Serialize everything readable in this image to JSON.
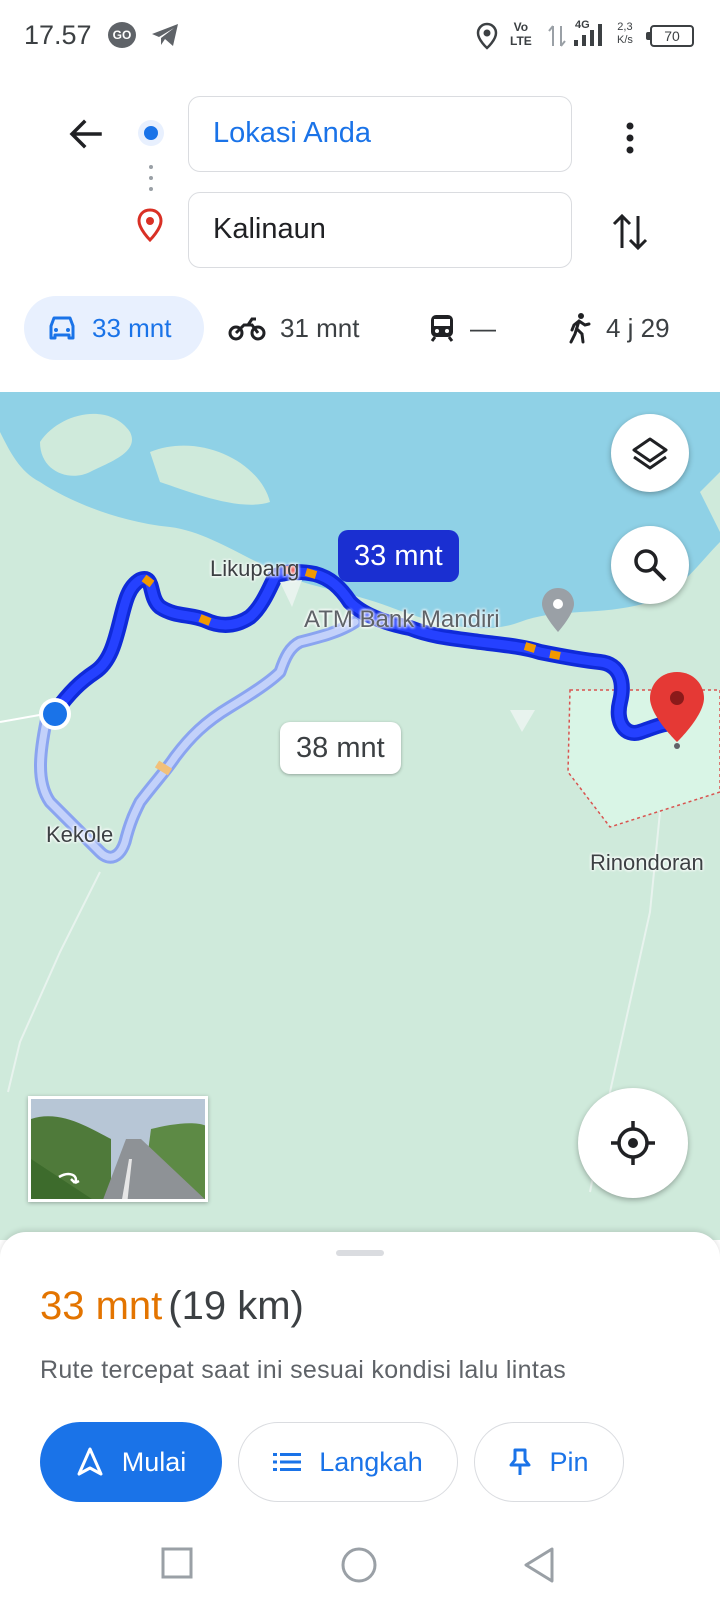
{
  "status_bar": {
    "time": "17.57",
    "go_badge": "GO",
    "volte_top": "Vo",
    "volte_bottom": "LTE",
    "network": "4G",
    "speed_top": "2,3",
    "speed_bottom": "K/s",
    "battery": "70"
  },
  "directions": {
    "origin": "Lokasi Anda",
    "destination": "Kalinaun"
  },
  "modes": [
    {
      "name": "car",
      "value": "33 mnt",
      "selected": true
    },
    {
      "name": "motorcycle",
      "value": "31 mnt",
      "selected": false
    },
    {
      "name": "transit",
      "value": "—",
      "selected": false
    },
    {
      "name": "walk",
      "value": "4 j 29",
      "selected": false
    }
  ],
  "map": {
    "labels": {
      "likupang": "Likupang",
      "atm": "ATM Bank Mandiri",
      "kekole": "Kekole",
      "rinondoran": "Rinondoran"
    },
    "primary_route_time": "33 mnt",
    "alt_route_time": "38 mnt",
    "colors": {
      "water": "#8fd1e6",
      "land": "#cfeadb",
      "route_primary": "#1a32e6",
      "route_alt": "#a6b9f7",
      "traffic": "#f29900",
      "destination_pin": "#e53935"
    }
  },
  "sheet": {
    "duration": "33 mnt",
    "distance": "(19 km)",
    "description": "Rute tercepat saat ini sesuai kondisi lalu lintas",
    "buttons": {
      "start": "Mulai",
      "steps": "Langkah",
      "pin": "Pin"
    }
  }
}
